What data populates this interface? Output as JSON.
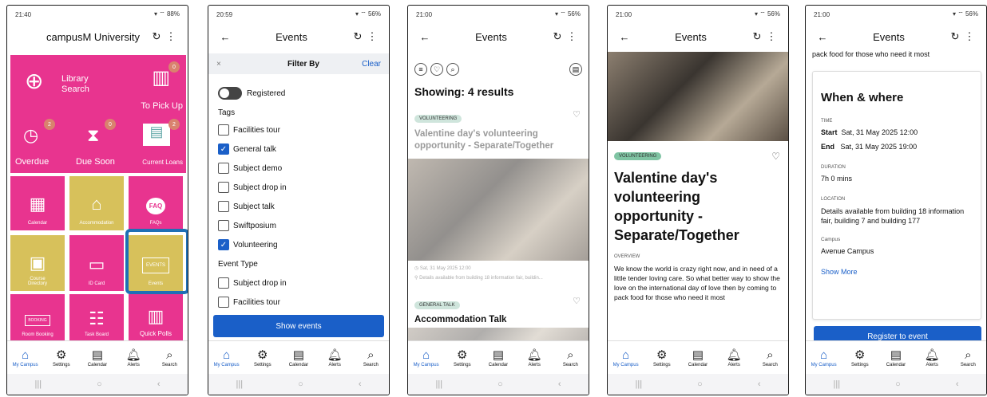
{
  "phone1": {
    "time": "21:40",
    "battery": "88%",
    "title": "campusM University",
    "tiles": {
      "library": "Library Search",
      "topickup": "To Pick Up",
      "overdue": "Overdue",
      "duesoon": "Due Soon",
      "currentloans": "Current Loans",
      "calendar": "Calendar",
      "accommodation": "Accommodation",
      "faqs": "FAQs",
      "course": "Course Directory",
      "idcard": "ID Card",
      "events": "Events",
      "roombooking": "Room Booking",
      "taskboard": "Task Board",
      "quickpolls": "Quick Polls"
    },
    "badges": {
      "topickup": "0",
      "overdue": "2",
      "duesoon": "0",
      "currentloans": "2"
    },
    "faq_icon": "FAQ",
    "booking_icon": "BOOKING",
    "events_icon": "EVENTS"
  },
  "phone2": {
    "time": "20:59",
    "battery": "56%",
    "title": "Events",
    "filter_title": "Filter By",
    "clear": "Clear",
    "registered": "Registered",
    "tags_heading": "Tags",
    "tags": [
      "Facilities tour",
      "General talk",
      "Subject demo",
      "Subject drop in",
      "Subject talk",
      "Swiftposium",
      "Volunteering"
    ],
    "event_type_heading": "Event Type",
    "types": [
      "Subject drop in",
      "Facilities tour"
    ],
    "show_events": "Show events"
  },
  "phone3": {
    "time": "21:00",
    "battery": "56%",
    "title": "Events",
    "results": "Showing: 4 results",
    "chip1": "VOLUNTEERING",
    "event1_title": "Valentine day's volunteering opportunity - Separate/Together",
    "event1_date": "Sat, 31 May 2025 12:00",
    "event1_location": "Details available from building 18 information fair, buildin...",
    "chip2": "GENERAL TALK",
    "event2_title": "Accommodation Talk"
  },
  "phone4": {
    "time": "21:00",
    "battery": "56%",
    "title": "Events",
    "chip": "VOLUNTEERING",
    "heading": "Valentine day's volunteering opportunity - Separate/Together",
    "overview_label": "OVERVIEW",
    "overview": "We know the world is crazy right now, and in need of a little tender loving care.  So what better way to show the love on the international day of love then by coming to pack food for those who need it most"
  },
  "phone5": {
    "time": "21:00",
    "battery": "56%",
    "title": "Events",
    "top_text": "pack food for those who need it most",
    "card_title": "When & where",
    "time_label": "TIME",
    "start_label": "Start",
    "start_value": "Sat, 31 May 2025 12:00",
    "end_label": "End",
    "end_value": "Sat, 31 May 2025 19:00",
    "duration_label": "DURATION",
    "duration": "7h 0 mins",
    "location_label": "LOCATION",
    "location": "Details available from building 18 information fair, building 7 and building 177",
    "campus_label": "Campus",
    "campus": "Avenue Campus",
    "show_more": "Show More",
    "register": "Register to event"
  },
  "nav": {
    "mycampus": "My Campus",
    "settings": "Settings",
    "calendar": "Calendar",
    "alerts": "Alerts",
    "search": "Search"
  },
  "colors": {
    "pink": "#e8348f",
    "gold": "#d7c15b",
    "blue": "#1a5fc8",
    "highlight": "#1f6fb5"
  }
}
